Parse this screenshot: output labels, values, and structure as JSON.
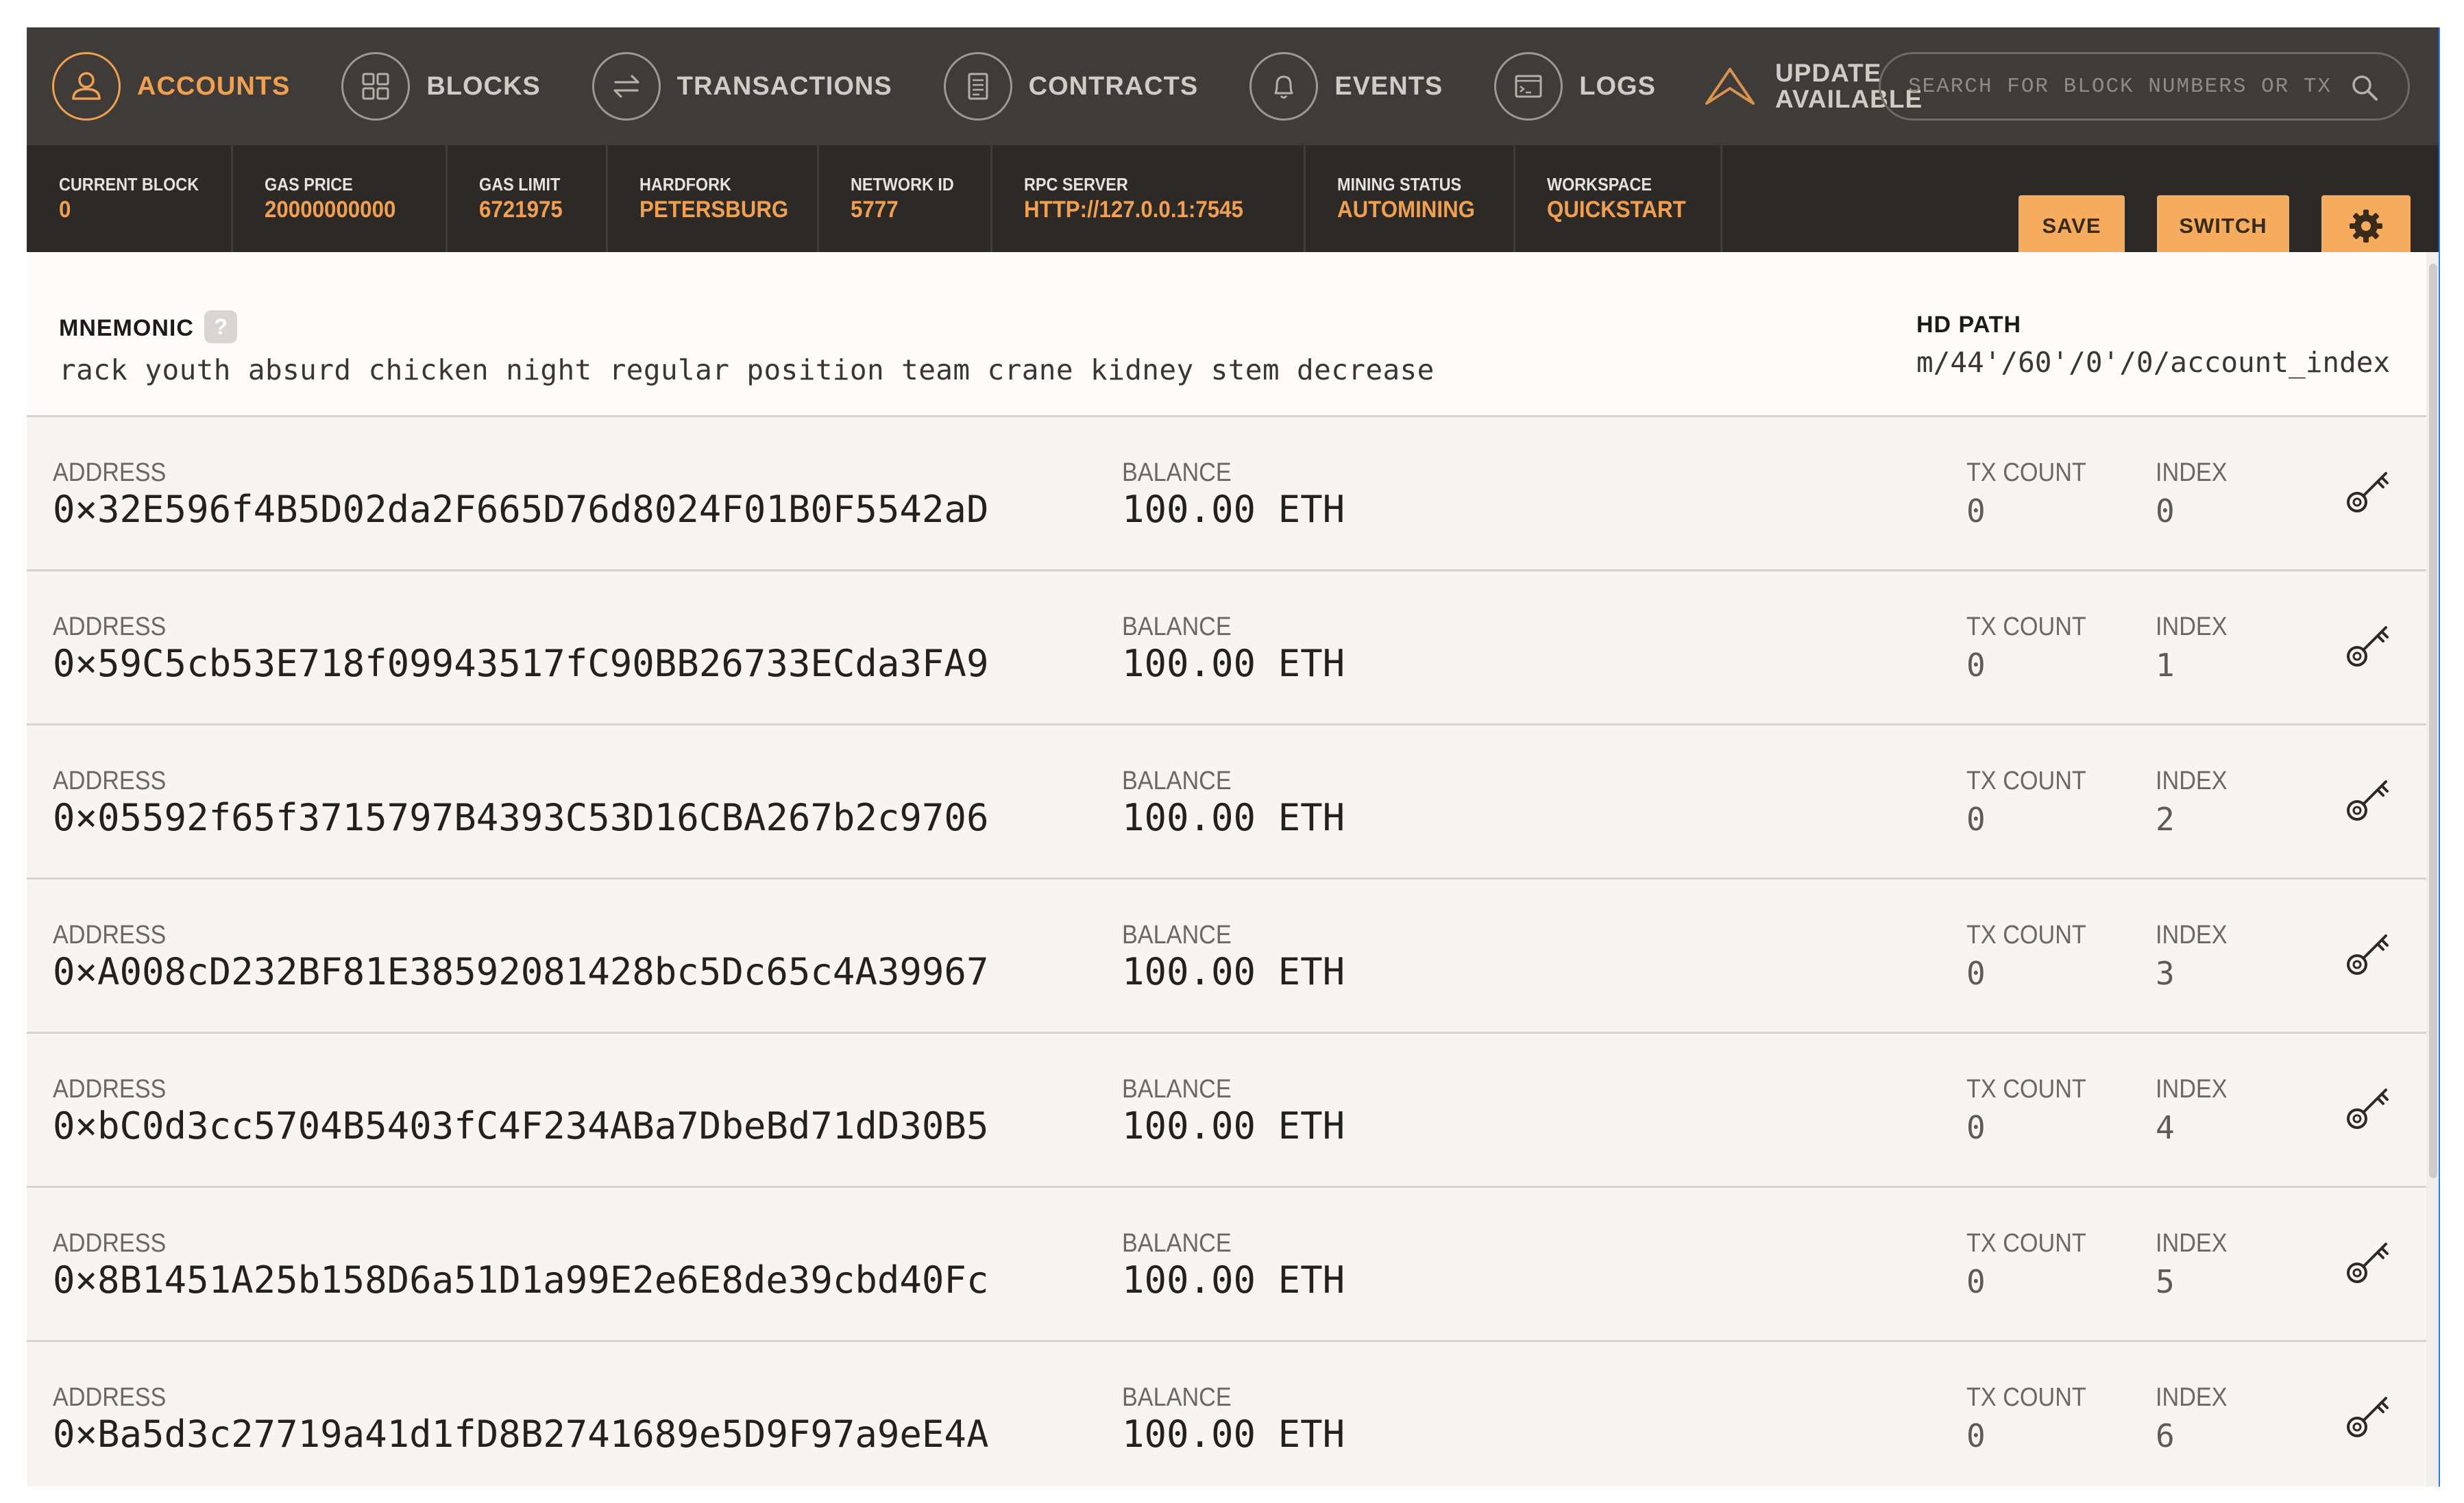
{
  "nav": {
    "items": [
      {
        "label": "ACCOUNTS",
        "icon": "user-icon",
        "active": true
      },
      {
        "label": "BLOCKS",
        "icon": "blocks-icon",
        "active": false
      },
      {
        "label": "TRANSACTIONS",
        "icon": "transfer-icon",
        "active": false
      },
      {
        "label": "CONTRACTS",
        "icon": "document-icon",
        "active": false
      },
      {
        "label": "EVENTS",
        "icon": "bell-icon",
        "active": false
      },
      {
        "label": "LOGS",
        "icon": "terminal-icon",
        "active": false
      }
    ],
    "update": {
      "line1": "UPDATE",
      "line2": "AVAILABLE"
    },
    "search_placeholder": "SEARCH FOR BLOCK NUMBERS OR TX HASHES"
  },
  "status": {
    "current_block": {
      "label": "CURRENT BLOCK",
      "value": "0"
    },
    "gas_price": {
      "label": "GAS PRICE",
      "value": "20000000000"
    },
    "gas_limit": {
      "label": "GAS LIMIT",
      "value": "6721975"
    },
    "hardfork": {
      "label": "HARDFORK",
      "value": "PETERSBURG"
    },
    "network_id": {
      "label": "NETWORK ID",
      "value": "5777"
    },
    "rpc_server": {
      "label": "RPC SERVER",
      "value": "HTTP://127.0.0.1:7545"
    },
    "mining_status": {
      "label": "MINING STATUS",
      "value": "AUTOMINING"
    },
    "workspace": {
      "label": "WORKSPACE",
      "value": "QUICKSTART"
    },
    "save_label": "SAVE",
    "switch_label": "SWITCH"
  },
  "mnemonic": {
    "label": "MNEMONIC",
    "help": "?",
    "value": "rack youth absurd chicken night regular position team crane kidney stem decrease",
    "hd_path_label": "HD PATH",
    "hd_path_value": "m/44'/60'/0'/0/account_index"
  },
  "labels": {
    "address": "ADDRESS",
    "balance": "BALANCE",
    "tx_count": "TX COUNT",
    "index": "INDEX"
  },
  "accounts": [
    {
      "address": "0×32E596f4B5D02da2F665D76d8024F01B0F5542aD",
      "balance": "100.00 ETH",
      "tx_count": "0",
      "index": "0"
    },
    {
      "address": "0×59C5cb53E718f09943517fC90BB26733ECda3FA9",
      "balance": "100.00 ETH",
      "tx_count": "0",
      "index": "1"
    },
    {
      "address": "0×05592f65f3715797B4393C53D16CBA267b2c9706",
      "balance": "100.00 ETH",
      "tx_count": "0",
      "index": "2"
    },
    {
      "address": "0×A008cD232BF81E38592081428bc5Dc65c4A39967",
      "balance": "100.00 ETH",
      "tx_count": "0",
      "index": "3"
    },
    {
      "address": "0×bC0d3cc5704B5403fC4F234ABa7DbeBd71dD30B5",
      "balance": "100.00 ETH",
      "tx_count": "0",
      "index": "4"
    },
    {
      "address": "0×8B1451A25b158D6a51D1a99E2e6E8de39cbd40Fc",
      "balance": "100.00 ETH",
      "tx_count": "0",
      "index": "5"
    },
    {
      "address": "0×Ba5d3c27719a41d1fD8B2741689e5D9F97a9eE4A",
      "balance": "100.00 ETH",
      "tx_count": "0",
      "index": "6"
    }
  ],
  "colors": {
    "accent": "#f0a050",
    "nav_bg": "#3e3b38",
    "status_bg": "#2c2926",
    "button": "#f5ac5e"
  }
}
